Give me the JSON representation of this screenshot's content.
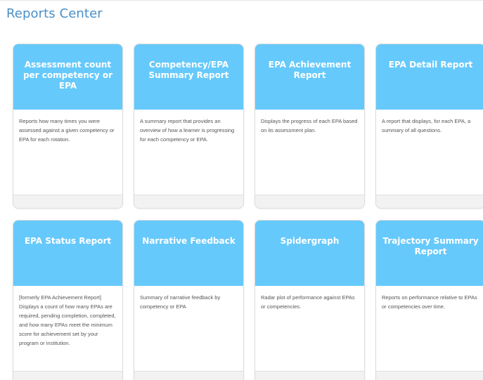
{
  "page": {
    "title": "Reports Center"
  },
  "reports": [
    {
      "title": "Assessment count per competency or EPA",
      "description": "Reports how many times you were assessed against a given competency or EPA for each rotation."
    },
    {
      "title": "Competency/EPA Summary Report",
      "description": "A summary report that provides an overview of how a learner is progressing for each competency or EPA."
    },
    {
      "title": "EPA Achievement Report",
      "description": "Displays the progress of each EPA based on its assessment plan."
    },
    {
      "title": "EPA Detail Report",
      "description": "A report that displays, for each EPA, a summary of all questions."
    },
    {
      "title": "EPA Status Report",
      "description": "[formerly EPA Achievement Report] Displays a count of how many EPAs are required, pending completion, completed, and how many EPAs meet the minimum score for achievement set by your program or institution."
    },
    {
      "title": "Narrative Feedback",
      "description": "Summary of narrative feedback by competency or EPA"
    },
    {
      "title": "Spidergraph",
      "description": "Radar plot of performance against EPAs or competencies."
    },
    {
      "title": "Trajectory Summary Report",
      "description": "Reports on performance relative to EPAs or competencies over time."
    }
  ],
  "colors": {
    "title_text": "#4a90c8",
    "card_header": "#66c9fb",
    "card_title_text": "#ffffff",
    "card_desc_text": "#555555",
    "card_footer": "#f2f2f2"
  }
}
